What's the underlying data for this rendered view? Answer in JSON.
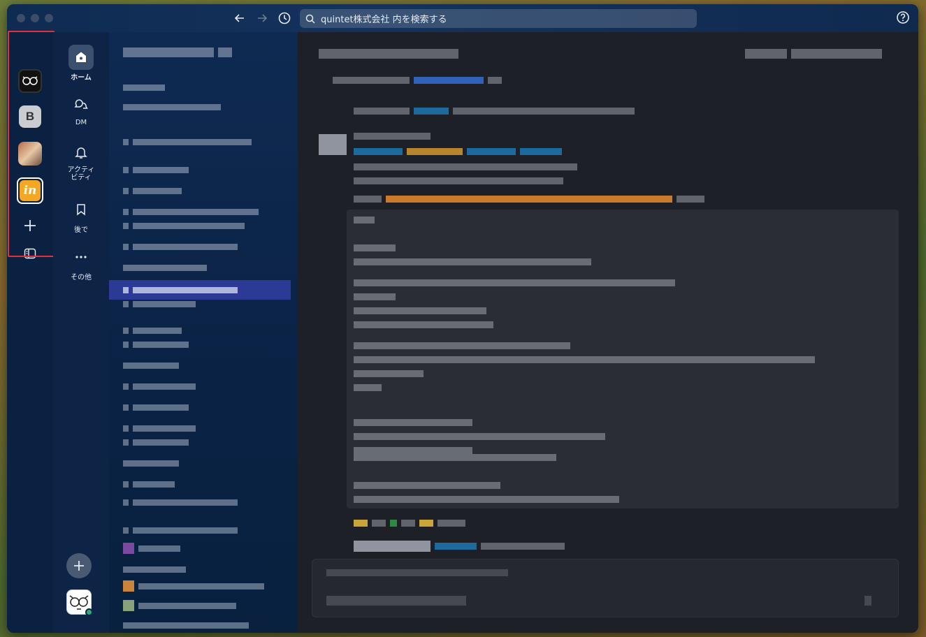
{
  "window": {
    "search_placeholder": "quintet株式会社 内を検索する"
  },
  "workspaces": [
    {
      "name": "workspace-1",
      "icon": "glasses-doodle-icon"
    },
    {
      "name": "workspace-2",
      "letter": "B"
    },
    {
      "name": "workspace-3",
      "icon": "photo-avatar"
    },
    {
      "name": "workspace-4",
      "letter": "in",
      "color": "#f5a623"
    }
  ],
  "nav": {
    "items": [
      {
        "label": "ホーム",
        "icon": "home-icon"
      },
      {
        "label": "DM",
        "icon": "chat-bubbles-icon"
      },
      {
        "label": "アクティビティ",
        "icon": "bell-icon"
      },
      {
        "label": "後で",
        "icon": "bookmark-icon"
      },
      {
        "label": "その他",
        "icon": "more-dots-icon"
      }
    ]
  },
  "colors": {
    "window_bg": "#0d2344",
    "main_bg": "#1d2127",
    "active_channel": "#2c3a96",
    "highlight_border": "#e0323c",
    "presence": "#2bac76"
  }
}
